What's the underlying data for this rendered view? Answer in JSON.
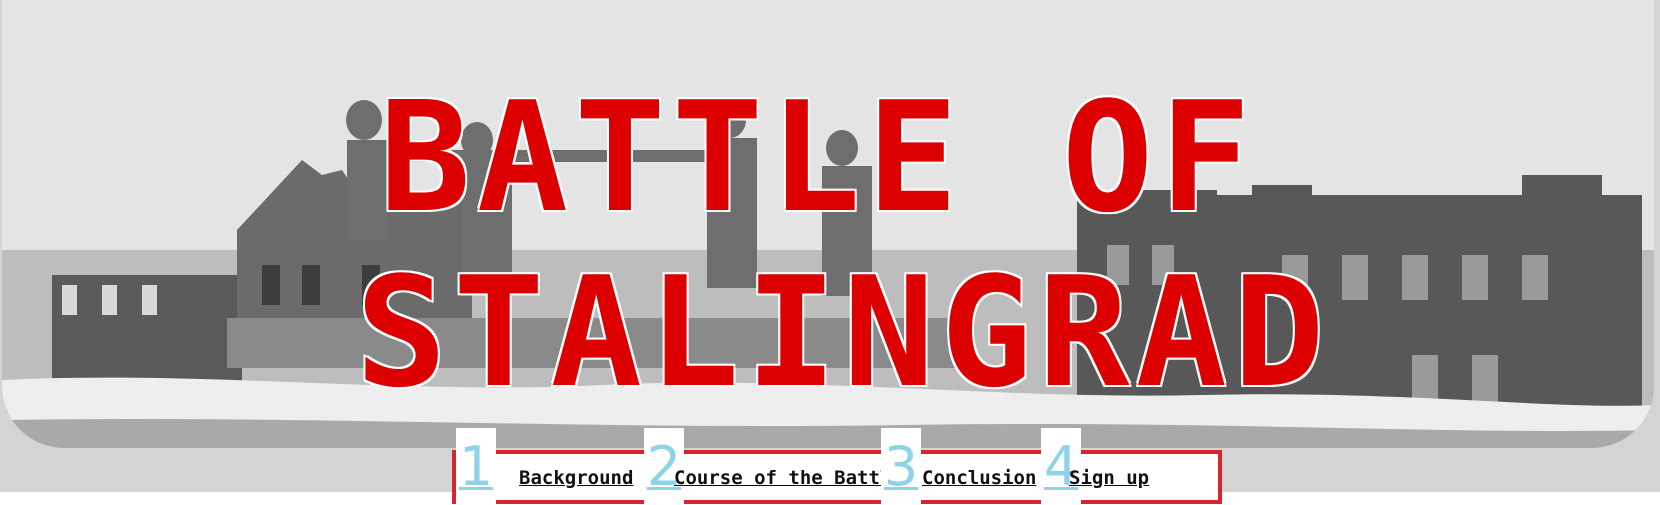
{
  "hero": {
    "title_line1": "BATTLE OF",
    "title_line2": "STALINGRAD",
    "title_color": "#dc0000",
    "image_description": "ruined-city-fountain-photo"
  },
  "nav": {
    "border_color": "#d8252d",
    "number_color": "#8fd3e8",
    "items": [
      {
        "num": "1",
        "label": "Background"
      },
      {
        "num": "2",
        "label": "Course of the Battle"
      },
      {
        "num": "3",
        "label": "Conclusion"
      },
      {
        "num": "4",
        "label": "Sign up"
      }
    ]
  }
}
